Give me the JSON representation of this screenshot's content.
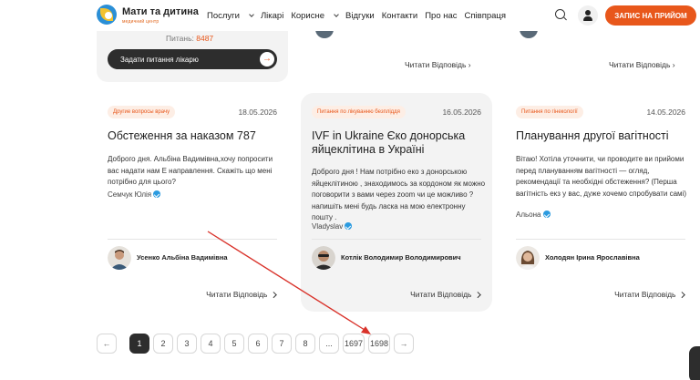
{
  "header": {
    "brand": "Мати та дитина",
    "brand_sub": "медичний центр",
    "nav": [
      {
        "label": "Послуги",
        "dropdown": true
      },
      {
        "label": "Лікарі",
        "dropdown": false
      },
      {
        "label": "Корисне",
        "dropdown": true
      },
      {
        "label": "Відгуки",
        "dropdown": false
      },
      {
        "label": "Контакти",
        "dropdown": false
      },
      {
        "label": "Про нас",
        "dropdown": false
      },
      {
        "label": "Співпраця",
        "dropdown": false
      }
    ],
    "cta": "ЗАПИС НА ПРИЙОМ",
    "accent": "#e8571b"
  },
  "top": {
    "questions_label": "Питань:",
    "questions_count": "8487",
    "ask_button": "Задати питання лікарю",
    "read_answer": "Читати Відповідь"
  },
  "cards": [
    {
      "tag": "Другие вопросы врачу",
      "date": "18.05.2026",
      "title": "Обстеження за наказом 787",
      "body": "Доброго дня. Альбіна Вадимівна,хочу попросити вас надати нам Е направлення. Скажіть що мені потрібно для цього?",
      "author": "Семчук Юлія",
      "doctor": "Усенко Альбіна Вадимівна",
      "read": "Читати Відповідь"
    },
    {
      "tag": "Питання по лікуванню безпліддя",
      "date": "16.05.2026",
      "title": "IVF in Ukraine Єко донорська яйцеклітина в Україні",
      "body": "Доброго дня ! Нам потрібно еко з донорською яйцеклітиною , знаходимось за кордоном як можно поговорити з вами через zoom чи це можливо ?напишіть мені будь ласка на мою електронну пошту .",
      "author": "Vladyslav",
      "doctor": "Котлік Володимир Володимирович",
      "read": "Читати Відповідь"
    },
    {
      "tag": "Питання по гінекології",
      "date": "14.05.2026",
      "title": "Планування другої вагітності",
      "body": "Вітаю! Хотіла уточнити, чи проводите ви прийоми перед плануванням вагітності — огляд, рекомендації та необхідні обстеження? (Перша вагітність екз у вас, дуже хочемо спробувати самі)",
      "author": "Альона",
      "doctor": "Холодян Ірина Ярославівна",
      "read": "Читати Відповідь"
    }
  ],
  "pagination": {
    "prev": "←",
    "pages": [
      "1",
      "2",
      "3",
      "4",
      "5",
      "6",
      "7",
      "8",
      "...",
      "1697",
      "1698"
    ],
    "current": "1",
    "next": "→"
  }
}
